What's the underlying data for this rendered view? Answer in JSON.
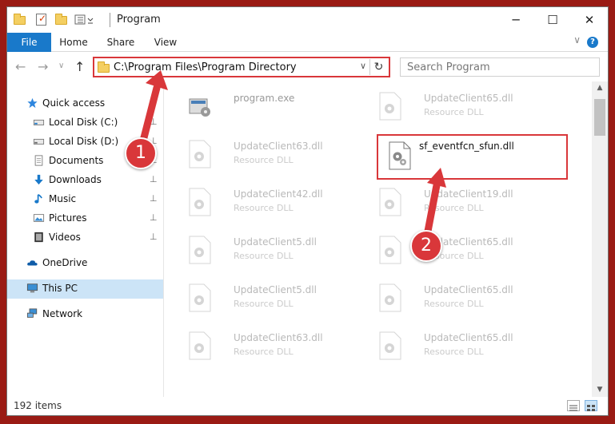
{
  "window": {
    "title": "Program",
    "minimize_glyph": "─",
    "maximize_glyph": "☐",
    "close_glyph": "✕"
  },
  "ribbon": {
    "tabs": [
      "File",
      "Home",
      "Share",
      "View"
    ],
    "help_glyph": "?",
    "collapse_glyph": "∨"
  },
  "nav": {
    "back_glyph": "←",
    "forward_glyph": "→",
    "recent_glyph": "∨",
    "up_glyph": "↑",
    "address": "C:\\Program Files\\Program Directory",
    "address_dropdown_glyph": "∨",
    "refresh_glyph": "↻",
    "search_placeholder": "Search Program"
  },
  "sidebar": {
    "items": [
      {
        "label": "Quick access",
        "icon": "star-icon",
        "pinned": false
      },
      {
        "label": "Local Disk (C:)",
        "icon": "drive-icon",
        "pinned": true
      },
      {
        "label": "Local Disk (D:)",
        "icon": "drive-icon",
        "pinned": true
      },
      {
        "label": "Documents",
        "icon": "documents-icon",
        "pinned": true
      },
      {
        "label": "Downloads",
        "icon": "download-icon",
        "pinned": true
      },
      {
        "label": "Music",
        "icon": "music-icon",
        "pinned": true
      },
      {
        "label": "Pictures",
        "icon": "pictures-icon",
        "pinned": true
      },
      {
        "label": "Videos",
        "icon": "videos-icon",
        "pinned": true
      },
      {
        "label": "OneDrive",
        "icon": "cloud-icon",
        "pinned": false
      },
      {
        "label": "This PC",
        "icon": "computer-icon",
        "pinned": false,
        "selected": true
      },
      {
        "label": "Network",
        "icon": "network-icon",
        "pinned": false
      }
    ],
    "pin_glyph": "📌"
  },
  "files": {
    "left": [
      {
        "name": "program.exe",
        "type": ""
      },
      {
        "name": "UpdateClient63.dll",
        "type": "Resource DLL"
      },
      {
        "name": "UpdateClient42.dll",
        "type": "Resource DLL"
      },
      {
        "name": "UpdateClient5.dll",
        "type": "Resource DLL"
      },
      {
        "name": "UpdateClient5.dll",
        "type": "Resource DLL"
      },
      {
        "name": "UpdateClient63.dll",
        "type": "Resource DLL"
      }
    ],
    "right": [
      {
        "name": "UpdateClient65.dll",
        "type": "Resource DLL"
      },
      {
        "name": "sf_eventfcn_sfun.dll",
        "type": "",
        "highlighted": true
      },
      {
        "name": "UpdateClient19.dll",
        "type": "Resource DLL"
      },
      {
        "name": "UpdateClient65.dll",
        "type": "Resource DLL"
      },
      {
        "name": "UpdateClient65.dll",
        "type": "Resource DLL"
      },
      {
        "name": "UpdateClient65.dll",
        "type": "Resource DLL"
      }
    ]
  },
  "scrollbar": {
    "up_glyph": "▲",
    "down_glyph": "▼"
  },
  "status": {
    "item_count": "192 items"
  },
  "callouts": {
    "step1": "1",
    "step2": "2"
  },
  "colors": {
    "accent": "#1979ca",
    "highlight": "#d9373a",
    "selected_nav": "#cce4f7",
    "background": "#9a1b14"
  }
}
